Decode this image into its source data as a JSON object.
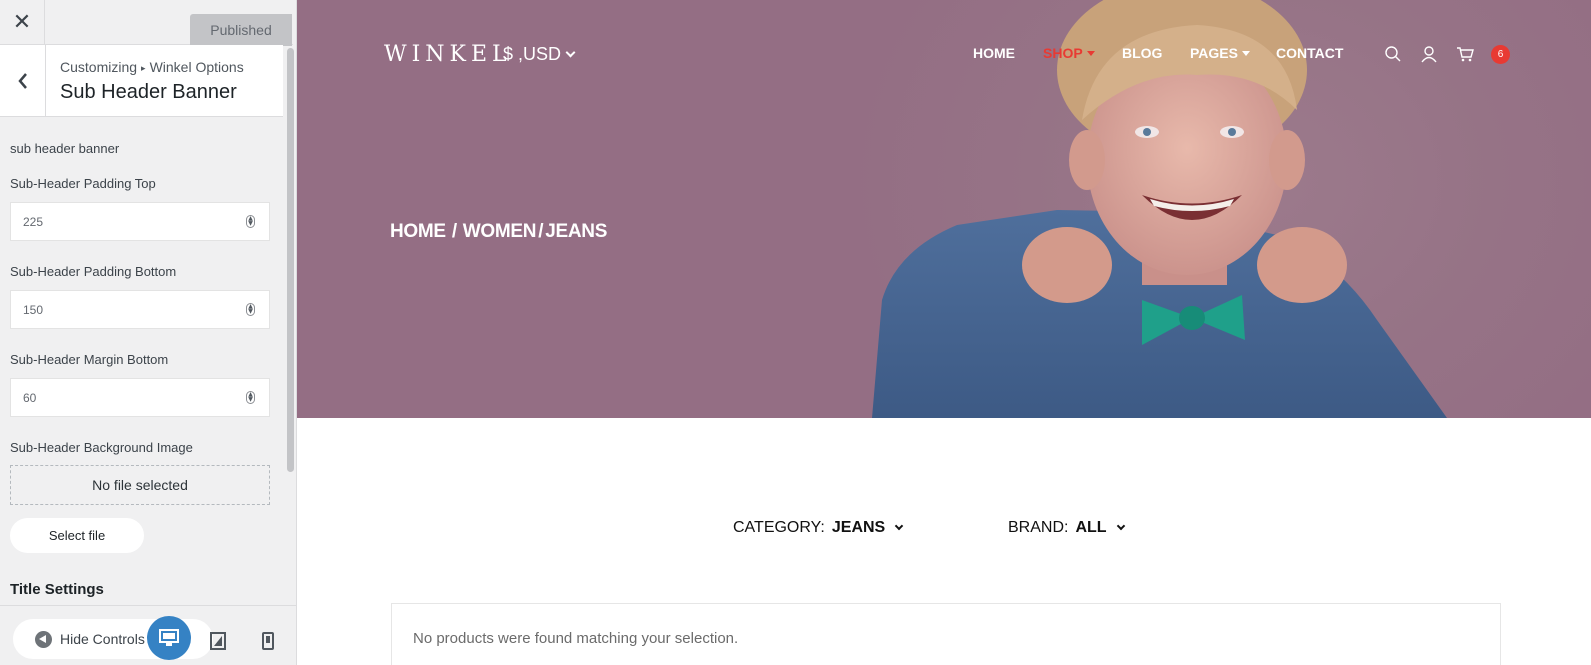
{
  "customizer": {
    "close_label": "✕",
    "publish_label": "Published",
    "breadcrumb": {
      "root": "Customizing",
      "separator": "▸",
      "parent": "Winkel Options"
    },
    "section_title": "Sub Header Banner",
    "group_label": "sub header banner",
    "fields": {
      "padding_top": {
        "label": "Sub-Header Padding Top",
        "value": "225"
      },
      "padding_bottom": {
        "label": "Sub-Header Padding Bottom",
        "value": "150"
      },
      "margin_bottom": {
        "label": "Sub-Header Margin Bottom",
        "value": "60"
      },
      "background_image": {
        "label": "Sub-Header Background Image",
        "empty_text": "No file selected",
        "button_label": "Select file"
      }
    },
    "next_section": "Title Settings",
    "footer": {
      "hide_controls_label": "Hide Controls",
      "active_device": "desktop"
    }
  },
  "site": {
    "logo": "WINKEL",
    "currency": "$ ,USD",
    "nav": [
      {
        "label": "HOME",
        "active": false
      },
      {
        "label": "SHOP",
        "active": true,
        "dropdown": true
      },
      {
        "label": "BLOG",
        "active": false
      },
      {
        "label": "PAGES",
        "active": false,
        "dropdown": true
      },
      {
        "label": "CONTACT",
        "active": false
      }
    ],
    "cart_count": "6",
    "breadcrumb": [
      "HOME",
      "WOMEN",
      "JEANS"
    ],
    "breadcrumb_separators": [
      "/",
      "/"
    ],
    "filters": {
      "category": {
        "label": "CATEGORY:",
        "value": "JEANS"
      },
      "brand": {
        "label": "BRAND:",
        "value": "ALL"
      }
    },
    "notice": "No products were found matching your selection.",
    "colors": {
      "accent": "#e83a33",
      "hero_overlay": "#967386",
      "wp_blue": "#3582c4"
    }
  }
}
